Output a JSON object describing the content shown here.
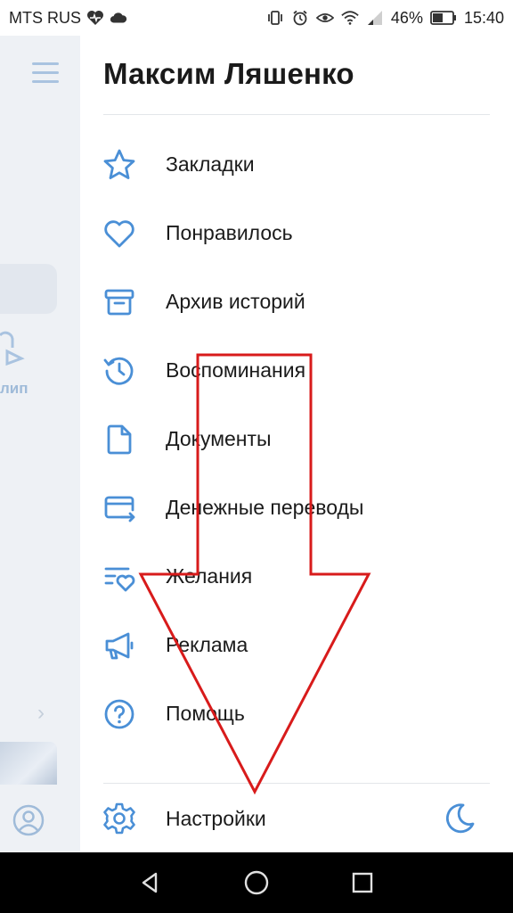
{
  "status_bar": {
    "carrier": "MTS RUS",
    "battery": "46%",
    "time": "15:40"
  },
  "underlay": {
    "clip_label": "лип"
  },
  "drawer": {
    "user_name": "Максим Ляшенко",
    "items": [
      {
        "label": "Закладки",
        "icon": "star-icon"
      },
      {
        "label": "Понравилось",
        "icon": "heart-icon"
      },
      {
        "label": "Архив историй",
        "icon": "archive-icon"
      },
      {
        "label": "Воспоминания",
        "icon": "history-icon"
      },
      {
        "label": "Документы",
        "icon": "document-icon"
      },
      {
        "label": "Денежные переводы",
        "icon": "card-transfer-icon"
      },
      {
        "label": "Желания",
        "icon": "wishlist-icon"
      },
      {
        "label": "Реклама",
        "icon": "megaphone-icon"
      },
      {
        "label": "Помощь",
        "icon": "help-icon"
      }
    ],
    "settings_label": "Настройки"
  },
  "colors": {
    "accent": "#4a8fd6",
    "annotation": "#d81b1b"
  }
}
